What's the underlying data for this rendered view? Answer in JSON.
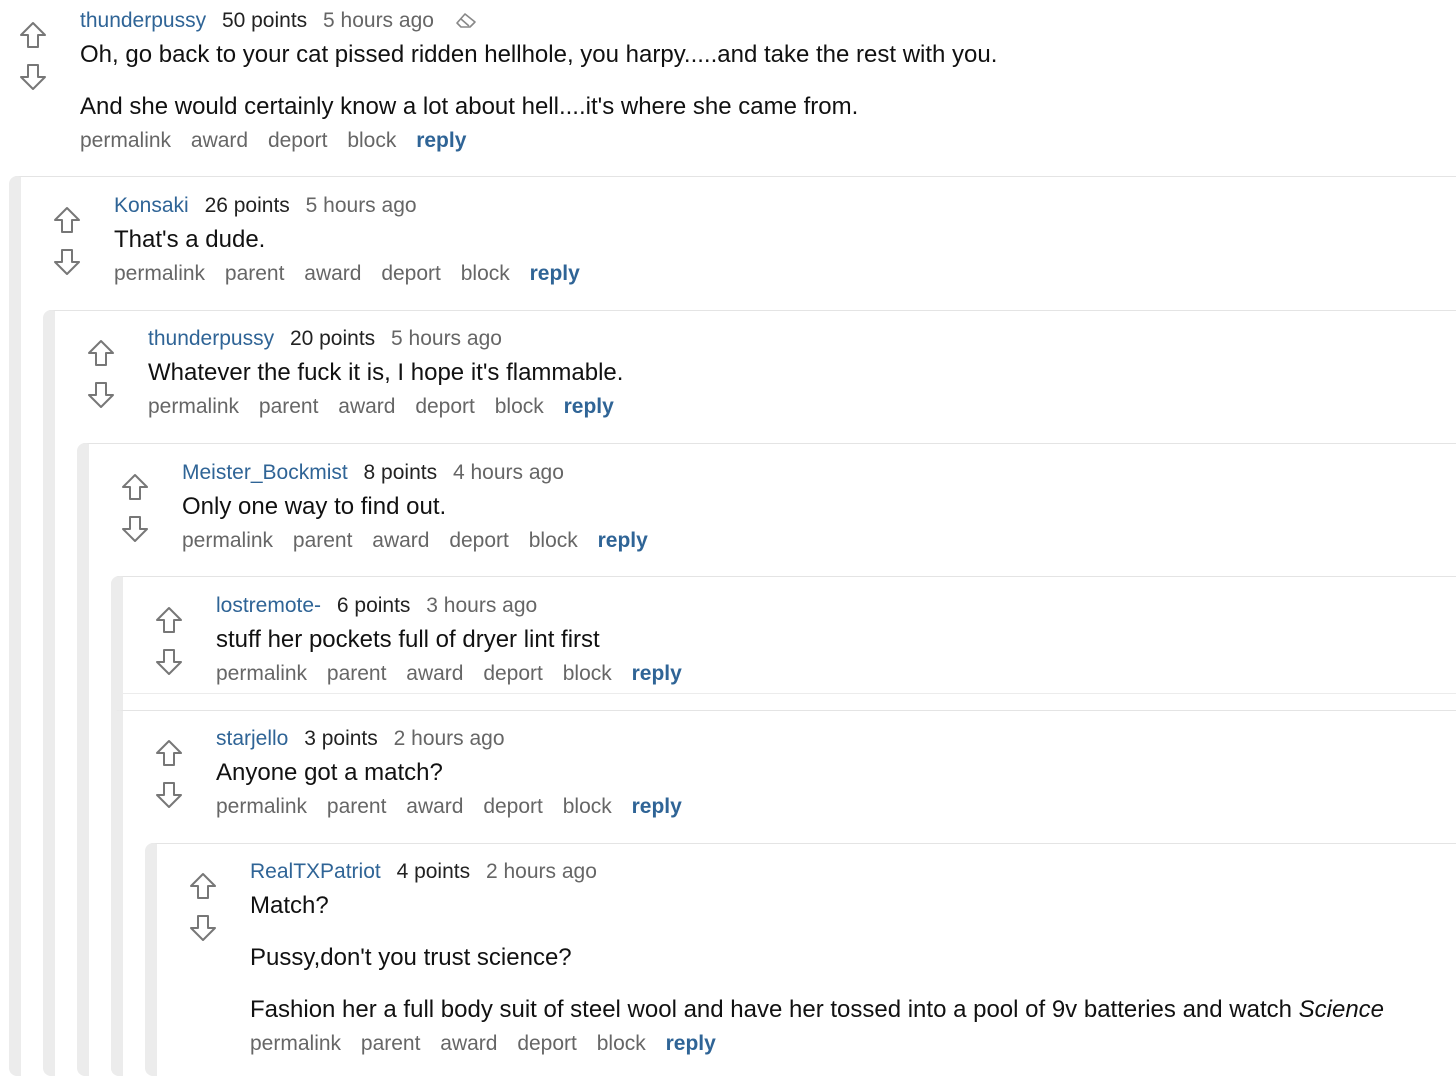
{
  "icons": {
    "upvote": "arrow-up-outline-icon",
    "downvote": "arrow-down-outline-icon",
    "edited": "eraser-icon"
  },
  "colors": {
    "author": "#2f6496",
    "reply": "#2f6496",
    "thread_bar": "#ececec"
  },
  "comments": [
    {
      "author": "thunderpussy",
      "points": "50 points",
      "time": "5 hours ago",
      "paragraphs": [
        "Oh, go back to your cat pissed ridden hellhole, you harpy.....and take the rest with you.",
        "And she would certainly know a lot about hell....it's where she came from."
      ],
      "actions": [
        "permalink",
        "award",
        "deport",
        "block",
        "reply"
      ]
    },
    {
      "author": "Konsaki",
      "points": "26 points",
      "time": "5 hours ago",
      "paragraphs": [
        "That's a dude."
      ],
      "actions": [
        "permalink",
        "parent",
        "award",
        "deport",
        "block",
        "reply"
      ]
    },
    {
      "author": "thunderpussy",
      "points": "20 points",
      "time": "5 hours ago",
      "paragraphs": [
        "Whatever the fuck it is, I hope it's flammable."
      ],
      "actions": [
        "permalink",
        "parent",
        "award",
        "deport",
        "block",
        "reply"
      ]
    },
    {
      "author": "Meister_Bockmist",
      "points": "8 points",
      "time": "4 hours ago",
      "paragraphs": [
        "Only one way to find out."
      ],
      "actions": [
        "permalink",
        "parent",
        "award",
        "deport",
        "block",
        "reply"
      ]
    },
    {
      "author": "lostremote-",
      "points": "6 points",
      "time": "3 hours ago",
      "paragraphs": [
        "stuff her pockets full of dryer lint first"
      ],
      "actions": [
        "permalink",
        "parent",
        "award",
        "deport",
        "block",
        "reply"
      ]
    },
    {
      "author": "starjello",
      "points": "3 points",
      "time": "2 hours ago",
      "paragraphs": [
        "Anyone got a match?"
      ],
      "actions": [
        "permalink",
        "parent",
        "award",
        "deport",
        "block",
        "reply"
      ]
    },
    {
      "author": "RealTXPatriot",
      "points": "4 points",
      "time": "2 hours ago",
      "paragraphs": [
        "Match?",
        "Pussy,don't you trust science?",
        "Fashion her a full body suit of steel wool and have her tossed into a pool of 9v batteries and watch ",
        "Science"
      ],
      "actions": [
        "permalink",
        "parent",
        "award",
        "deport",
        "block",
        "reply"
      ]
    }
  ]
}
